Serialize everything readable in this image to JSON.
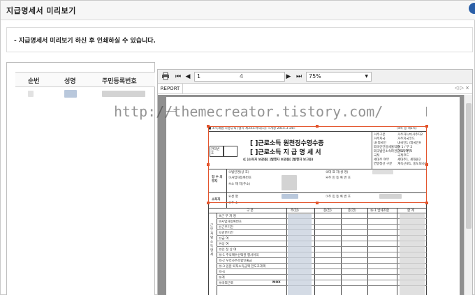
{
  "window": {
    "title": "지급명세서 미리보기"
  },
  "notice": {
    "text": "- 지급명세서 미리보기 하신 후 인쇄하실 수 있습니다."
  },
  "list": {
    "columns": [
      "순번",
      "성명",
      "주민등록번호"
    ]
  },
  "viewer": {
    "current_page": "1",
    "total_pages": "4",
    "zoom": "75%",
    "tab": "REPORT",
    "tab_nav": "◁ ▷ ×"
  },
  "document": {
    "header_left": "■ 소득세법 시행규칙 [별지 제24호서식(1)] <개정 2014.3.14>",
    "header_right": "(4쪽 중 제1쪽)",
    "title_line1": "[ ]근로소득 원천징수영수증",
    "title_line2": "[ ]근로소득 지 급 명 세 서",
    "subtitle": "([ ]소득자 보관용[ ]발행자 보관용[ ]발행자 보고용)",
    "mgmt_label": "관리번호",
    "sections": {
      "payer": "징 수 의무자",
      "earner": "소득자",
      "detail": "근 무 처 별 소 득 명 세"
    },
    "payer_rows": [
      "①법인명(상 호)",
      "③사업자등록번호",
      "④소 재 지(주소)"
    ],
    "payer_right": [
      "②대 표 자(성 명)",
      "④주 민 등 록 번 호"
    ],
    "earner_rows": [
      "⑥성 명",
      "⑧주 소"
    ],
    "earner_right": [
      "⑦주 민 등 록 번 호"
    ],
    "table_header": [
      "구 분",
      "주(현)",
      "종(전)",
      "종(전)",
      "⑯-1 납세조합",
      "합 계"
    ],
    "table_rows": [
      "⑨근 무 처 명",
      "⑩사업자등록번호",
      "⑪근무기간",
      "⑫감면기간",
      "⑬급 여",
      "⑭상 여",
      "⑮인 정 상 여",
      "⑮-1 주식매수선택권 행사이익",
      "⑮-2 우리사주조합인출금",
      "⑮-3 임원 퇴직소득금액 한도초과액",
      "⑮-4",
      "⑯계",
      "⑱국외근로"
    ],
    "row_code": "MOX",
    "right_box_labels": [
      "거주구분",
      "거주지국",
      "내·외국인",
      "외국인단일세율적용",
      "외국법인소속파견근로자여부",
      "국적",
      "세대주 여부",
      "연말정산 구분"
    ],
    "right_box_values": [
      "거주자1/비거주자2",
      "거주지국코드",
      "내국인1 /외국인9",
      "여 1 / 부 2",
      "여 1 / 부 2",
      "국적코드",
      "세대주1, 세대원2",
      "계속근로1, 중도퇴사2"
    ]
  },
  "watermark": "http://themecreator.tistory.com/",
  "colors": {
    "selection": "#e3542c",
    "viewer_bg": "#8f8f8f",
    "blur_blue": "#b9c8dc",
    "blur_gray": "#d3d3d3"
  }
}
